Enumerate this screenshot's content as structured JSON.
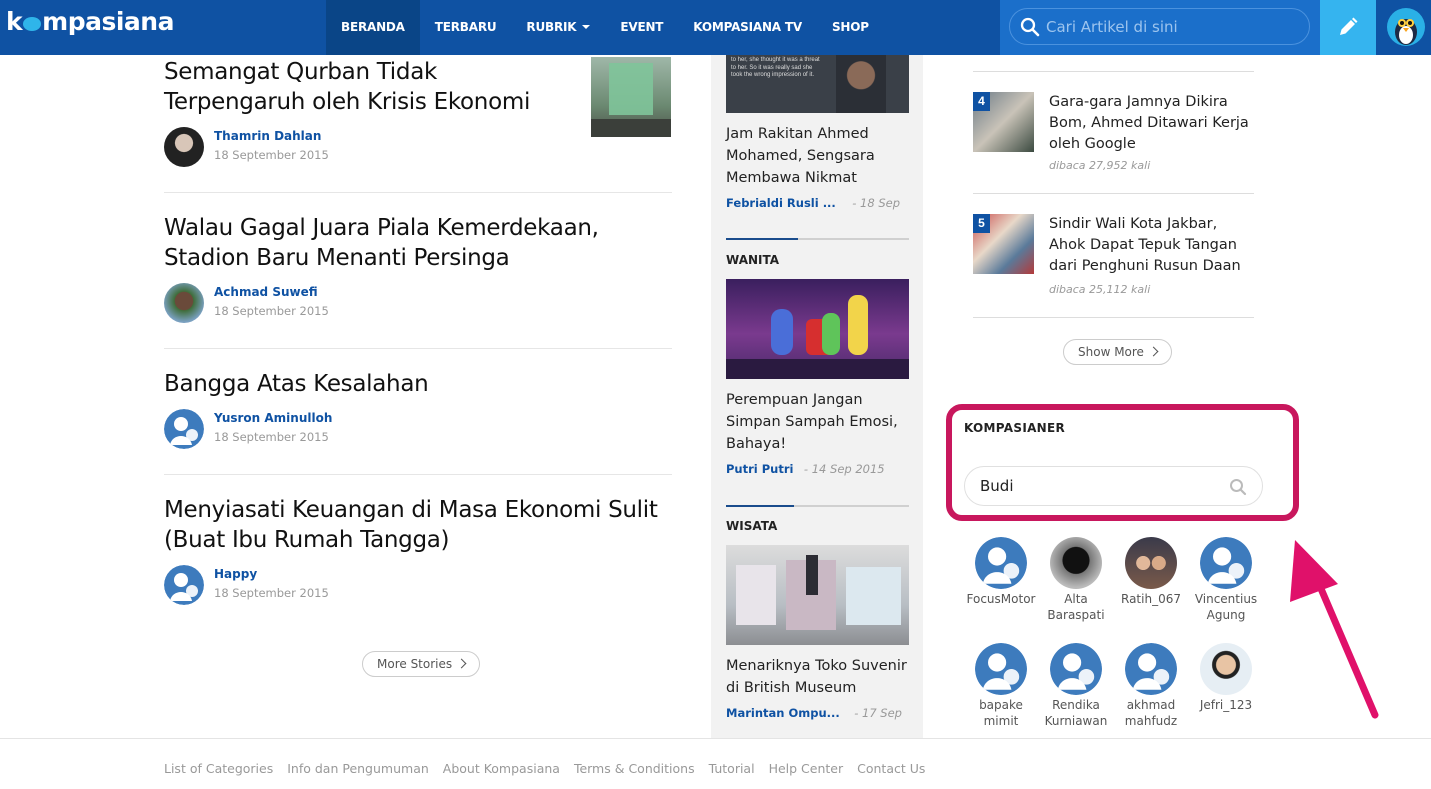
{
  "header": {
    "logo_text": "kompasiana",
    "nav": [
      {
        "label": "BERANDA",
        "active": true
      },
      {
        "label": "TERBARU"
      },
      {
        "label": "RUBRIK",
        "dropdown": true
      },
      {
        "label": "EVENT"
      },
      {
        "label": "KOMPASIANA TV"
      },
      {
        "label": "SHOP"
      }
    ],
    "search_placeholder": "Cari Artikel di sini",
    "write_icon": "pencil-icon",
    "avatar_icon": "penguin-avatar"
  },
  "stories": [
    {
      "title": "Semangat Qurban Tidak Terpengaruh oleh Krisis Ekonomi",
      "author": "Thamrin Dahlan",
      "date": "18 September 2015"
    },
    {
      "title": "Walau Gagal Juara Piala Kemerdekaan, Stadion Baru Menanti Persinga",
      "author": "Achmad Suwefi",
      "date": "18 September 2015"
    },
    {
      "title": "Bangga Atas Kesalahan",
      "author": "Yusron Aminulloh",
      "date": "18 September 2015"
    },
    {
      "title": "Menyiasati Keuangan di Masa Ekonomi Sulit (Buat Ibu Rumah Tangga)",
      "author": "Happy",
      "date": "18 September 2015"
    }
  ],
  "more_stories_label": "More Stories",
  "middle": {
    "top_item": {
      "title": "Jam Rakitan Ahmed Mohamed, Sengsara Membawa Nikmat",
      "author": "Febrialdi Rusli ...",
      "date": "- 18 Sep",
      "thumb_text": "to her, she thought it was a threat to her. So it was really sad she took the wrong impression of it."
    },
    "sections": [
      {
        "heading": "WANITA",
        "title": "Perempuan Jangan Simpan Sampah Emosi, Bahaya!",
        "author": "Putri Putri",
        "date": "- 14 Sep 2015"
      },
      {
        "heading": "WISATA",
        "title": "Menariknya Toko Suvenir di British Museum",
        "author": "Marintan Ompu...",
        "date": "- 17 Sep"
      }
    ]
  },
  "popular": [
    {
      "rank": "4",
      "title": "Gara-gara Jamnya Dikira Bom, Ahmed Ditawari Kerja oleh Google",
      "reads": "dibaca 27,952 kali"
    },
    {
      "rank": "5",
      "title": "Sindir Wali Kota Jakbar, Ahok Dapat Tepuk Tangan dari Penghuni Rusun Daan",
      "reads": "dibaca 25,112 kali"
    }
  ],
  "show_more_label": "Show More",
  "kompasianer": {
    "heading": "KOMPASIANER",
    "search_value": "Budi",
    "highlight_color": "#c8175d",
    "users": [
      {
        "name": "FocusMotor",
        "avatar": "default"
      },
      {
        "name": "Alta Baraspati",
        "avatar": "photo-dark"
      },
      {
        "name": "Ratih_067",
        "avatar": "photo-couple"
      },
      {
        "name": "Vincentius Agung",
        "avatar": "default"
      },
      {
        "name": "bapake mimit",
        "avatar": "default"
      },
      {
        "name": "Rendika Kurniawan",
        "avatar": "default"
      },
      {
        "name": "akhmad mahfudz",
        "avatar": "default"
      },
      {
        "name": "Jefri_123",
        "avatar": "photo-man"
      }
    ]
  },
  "footer_links": [
    "List of Categories",
    "Info dan Pengumuman",
    "About Kompasiana",
    "Terms & Conditions",
    "Tutorial",
    "Help Center",
    "Contact Us"
  ],
  "colors": {
    "brand": "#0f52a3",
    "accent": "#35b4ef",
    "link": "#0f52a3"
  }
}
